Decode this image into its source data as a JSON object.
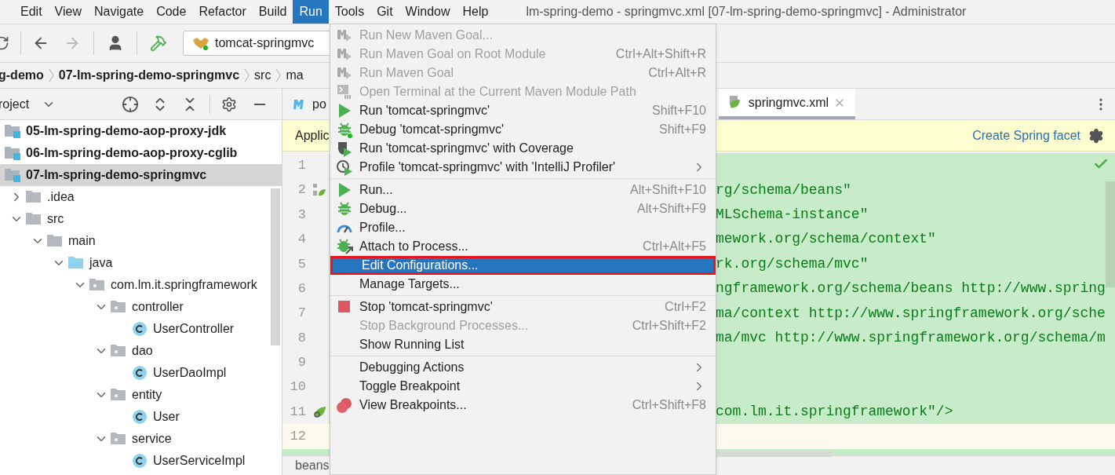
{
  "menubar": {
    "items": [
      {
        "label": "Edit",
        "selected": false
      },
      {
        "label": "View",
        "selected": false
      },
      {
        "label": "Navigate",
        "selected": false
      },
      {
        "label": "Code",
        "selected": false
      },
      {
        "label": "Refactor",
        "selected": false
      },
      {
        "label": "Build",
        "selected": false
      },
      {
        "label": "Run",
        "selected": true
      },
      {
        "label": "Tools",
        "selected": false
      },
      {
        "label": "Git",
        "selected": false
      },
      {
        "label": "Window",
        "selected": false
      },
      {
        "label": "Help",
        "selected": false
      }
    ],
    "title": "lm-spring-demo - springmvc.xml [07-lm-spring-demo-springmvc] - Administrator"
  },
  "toolbar": {
    "run_configuration": "tomcat-springmvc",
    "forward_disabled": true
  },
  "breadcrumbs": [
    {
      "label": "g-demo",
      "bold": true
    },
    {
      "label": "07-lm-spring-demo-springmvc",
      "bold": true
    },
    {
      "label": "src",
      "bold": false
    },
    {
      "label": "ma",
      "bold": false
    }
  ],
  "project": {
    "title": "roject",
    "tree": [
      {
        "label": "05-lm-spring-demo-aop-proxy-jdk",
        "kind": "module",
        "selected": false
      },
      {
        "label": "06-lm-spring-demo-aop-proxy-cglib",
        "kind": "module",
        "selected": false
      },
      {
        "label": "07-lm-spring-demo-springmvc",
        "kind": "module",
        "selected": true,
        "children": [
          {
            "label": ".idea",
            "kind": "folder",
            "selected": false,
            "expanded": false
          },
          {
            "label": "src",
            "kind": "folder",
            "selected": false,
            "expanded": true,
            "children": [
              {
                "label": "main",
                "kind": "folder",
                "selected": false,
                "expanded": true,
                "children": [
                  {
                    "label": "java",
                    "kind": "source",
                    "selected": false,
                    "expanded": true,
                    "children": [
                      {
                        "label": "com.lm.it.springframework",
                        "kind": "package",
                        "selected": false,
                        "expanded": true,
                        "children": [
                          {
                            "label": "controller",
                            "kind": "package",
                            "selected": false,
                            "expanded": true,
                            "children": [
                              {
                                "label": "UserController",
                                "kind": "class",
                                "selected": false
                              }
                            ]
                          },
                          {
                            "label": "dao",
                            "kind": "package",
                            "selected": false,
                            "expanded": true,
                            "children": [
                              {
                                "label": "UserDaoImpl",
                                "kind": "class",
                                "selected": false
                              }
                            ]
                          },
                          {
                            "label": "entity",
                            "kind": "package",
                            "selected": false,
                            "expanded": true,
                            "children": [
                              {
                                "label": "User",
                                "kind": "class",
                                "selected": false
                              }
                            ]
                          },
                          {
                            "label": "service",
                            "kind": "package",
                            "selected": false,
                            "expanded": true,
                            "children": [
                              {
                                "label": "UserServiceImpl",
                                "kind": "class",
                                "selected": false
                              }
                            ]
                          }
                        ]
                      }
                    ]
                  }
                ]
              }
            ]
          }
        ]
      }
    ]
  },
  "editor": {
    "tabs": [
      {
        "label": "po",
        "kind": "maven",
        "selected": false
      },
      {
        "label": "springmvc.xml",
        "kind": "spring",
        "selected": true
      }
    ],
    "banner": {
      "text": "Applic",
      "link": "Create Spring facet"
    },
    "lines": [
      {
        "number": "1",
        "kind": "plain",
        "current": false
      },
      {
        "number": "2",
        "text": "rg/schema/beans\"",
        "kind": "beans",
        "current": false
      },
      {
        "number": "3",
        "text": "MLSchema-instance\"",
        "kind": "plain",
        "current": false
      },
      {
        "number": "4",
        "text": "mework.org/schema/context\"",
        "kind": "plain",
        "current": false
      },
      {
        "number": "5",
        "text": "rk.org/schema/mvc\"",
        "kind": "plain",
        "current": false
      },
      {
        "number": "6",
        "text": "ngframework.org/schema/beans http://www.spring",
        "kind": "plain",
        "current": false
      },
      {
        "number": "7",
        "text": "ma/context http://www.springframework.org/sche",
        "kind": "plain",
        "current": false
      },
      {
        "number": "8",
        "text": "ma/mvc http://www.springframework.org/schema/m",
        "kind": "plain",
        "current": false
      },
      {
        "number": "9",
        "kind": "plain",
        "current": false
      },
      {
        "number": "10",
        "kind": "plain",
        "current": false
      },
      {
        "number": "11",
        "text": "com.lm.it.springframework\"/>",
        "kind": "spring",
        "current": false
      },
      {
        "number": "12",
        "kind": "plain",
        "current": true
      }
    ],
    "breadcrumb": "beans"
  },
  "run_menu": [
    {
      "kind": "maven",
      "label": "Run New Maven Goal...",
      "disabled": true,
      "selected": false
    },
    {
      "kind": "maven",
      "label": "Run Maven Goal on Root Module",
      "shortcut": "Ctrl+Alt+Shift+R",
      "disabled": true,
      "selected": false
    },
    {
      "kind": "maven",
      "label": "Run Maven Goal",
      "shortcut": "Ctrl+Alt+R",
      "disabled": true,
      "selected": false
    },
    {
      "kind": "terminal",
      "label": "Open Terminal at the Current Maven Module Path",
      "disabled": true,
      "selected": false
    },
    {
      "kind": "run",
      "label": "Run 'tomcat-springmvc'",
      "shortcut": "Shift+F10",
      "disabled": false,
      "selected": false
    },
    {
      "kind": "debugging",
      "label": "Debug 'tomcat-springmvc'",
      "shortcut": "Shift+F9",
      "disabled": false,
      "selected": false
    },
    {
      "kind": "coverage",
      "label": "Run 'tomcat-springmvc' with Coverage",
      "disabled": false,
      "selected": false
    },
    {
      "kind": "profiler",
      "label": "Profile 'tomcat-springmvc' with 'IntelliJ Profiler'",
      "submenu": true,
      "disabled": false,
      "selected": false
    },
    {
      "kind": "separator"
    },
    {
      "kind": "run",
      "label": "Run...",
      "shortcut": "Alt+Shift+F10",
      "disabled": false,
      "selected": false
    },
    {
      "kind": "debug",
      "label": "Debug...",
      "shortcut": "Alt+Shift+F9",
      "disabled": false,
      "selected": false
    },
    {
      "kind": "gauge",
      "label": "Profile...",
      "disabled": false,
      "selected": false
    },
    {
      "kind": "attach",
      "label": "Attach to Process...",
      "shortcut": "Ctrl+Alt+F5",
      "disabled": false,
      "selected": false
    },
    {
      "kind": "plain",
      "label": "Edit Configurations...",
      "disabled": false,
      "selected": true
    },
    {
      "kind": "plain",
      "label": "Manage Targets...",
      "disabled": false,
      "selected": false
    },
    {
      "kind": "separator"
    },
    {
      "kind": "stop",
      "label": "Stop 'tomcat-springmvc'",
      "shortcut": "Ctrl+F2",
      "disabled": false,
      "selected": false
    },
    {
      "kind": "plain",
      "label": "Stop Background Processes...",
      "shortcut": "Ctrl+Shift+F2",
      "disabled": true,
      "selected": false
    },
    {
      "kind": "plain",
      "label": "Show Running List",
      "disabled": false,
      "selected": false
    },
    {
      "kind": "separator"
    },
    {
      "kind": "plain",
      "label": "Debugging Actions",
      "submenu": true,
      "disabled": false,
      "selected": false
    },
    {
      "kind": "plain",
      "label": "Toggle Breakpoint",
      "submenu": true,
      "disabled": false,
      "selected": false
    },
    {
      "kind": "breakpoints",
      "label": "View Breakpoints...",
      "shortcut": "Ctrl+Shift+F8",
      "disabled": false,
      "selected": false
    }
  ]
}
